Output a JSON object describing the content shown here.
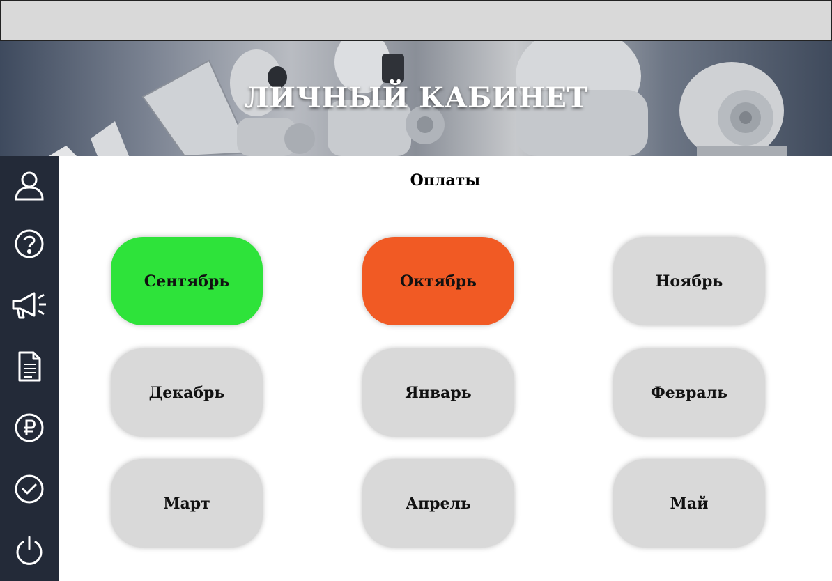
{
  "header": {
    "title": "ЛИЧНЫЙ КАБИНЕТ"
  },
  "sidebar": {
    "items": [
      {
        "icon": "user-icon"
      },
      {
        "icon": "help-icon"
      },
      {
        "icon": "megaphone-icon"
      },
      {
        "icon": "document-icon"
      },
      {
        "icon": "ruble-icon"
      },
      {
        "icon": "check-circle-icon"
      },
      {
        "icon": "power-icon"
      }
    ]
  },
  "main": {
    "title": "Оплаты",
    "months": [
      {
        "label": "Сентябрь",
        "status": "paid",
        "color": "#2ee33a"
      },
      {
        "label": "Октябрь",
        "status": "overdue",
        "color": "#f15a24"
      },
      {
        "label": "Ноябрь",
        "status": "pending",
        "color": "#d9d9d9"
      },
      {
        "label": "Декабрь",
        "status": "pending",
        "color": "#d9d9d9"
      },
      {
        "label": "Январь",
        "status": "pending",
        "color": "#d9d9d9"
      },
      {
        "label": "Февраль",
        "status": "pending",
        "color": "#d9d9d9"
      },
      {
        "label": "Март",
        "status": "pending",
        "color": "#d9d9d9"
      },
      {
        "label": "Апрель",
        "status": "pending",
        "color": "#d9d9d9"
      },
      {
        "label": "Май",
        "status": "pending",
        "color": "#d9d9d9"
      }
    ]
  },
  "colors": {
    "sidebar_bg": "#232a38",
    "topbar_bg": "#d9d9d9"
  }
}
